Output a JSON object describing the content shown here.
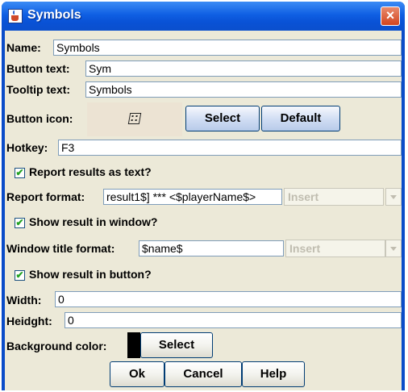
{
  "window": {
    "title": "Symbols",
    "close_label": "×"
  },
  "fields": {
    "name_label": "Name:",
    "name_value": "Symbols",
    "button_text_label": "Button text:",
    "button_text_value": "Sym",
    "tooltip_label": "Tooltip text:",
    "tooltip_value": "Symbols",
    "button_icon_label": "Button icon:",
    "icon_select_label": "Select",
    "icon_default_label": "Default",
    "hotkey_label": "Hotkey:",
    "hotkey_value": "F3",
    "report_as_text_label": "Report results as text?",
    "report_as_text_checked": true,
    "report_format_label": "Report format:",
    "report_format_value": "result1$] *** <$playerName$>",
    "report_insert_label": "Insert",
    "show_in_window_label": "Show result in window?",
    "show_in_window_checked": true,
    "window_title_format_label": "Window title format:",
    "window_title_format_value": "$name$",
    "window_insert_label": "Insert",
    "show_in_button_label": "Show result in button?",
    "show_in_button_checked": true,
    "width_label": "Width:",
    "width_value": "0",
    "height_label": "Heidght:",
    "height_value": "0",
    "bg_color_label": "Background color:",
    "bg_color_value": "#000000",
    "bg_select_label": "Select"
  },
  "buttons": {
    "ok": "Ok",
    "cancel": "Cancel",
    "help": "Help"
  },
  "check_glyph": "✔"
}
